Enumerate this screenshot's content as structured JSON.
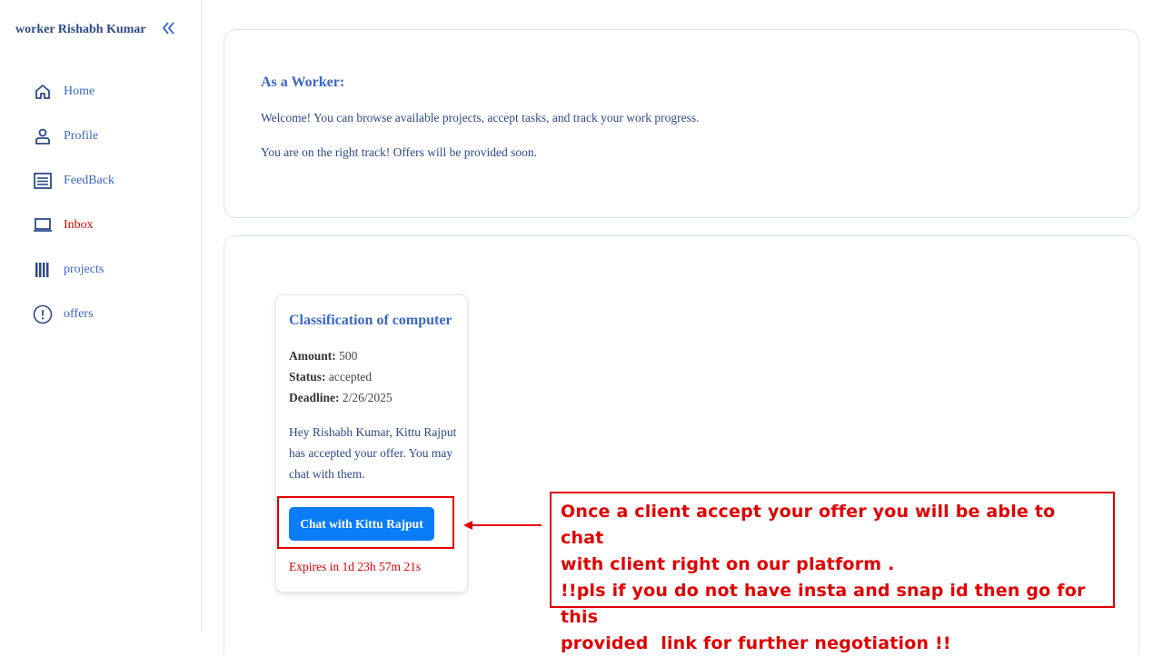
{
  "sidebar": {
    "brand": "worker Rishabh Kumar",
    "collapse_icon": "double-chevron-left-icon",
    "items": [
      {
        "label": "Home",
        "icon": "home-icon"
      },
      {
        "label": "Profile",
        "icon": "user-icon"
      },
      {
        "label": "FeedBack",
        "icon": "list-icon"
      },
      {
        "label": "Inbox",
        "icon": "inbox-icon",
        "active": true
      },
      {
        "label": "projects",
        "icon": "barcode-icon"
      },
      {
        "label": "offers",
        "icon": "alert-circle-icon"
      }
    ]
  },
  "welcome": {
    "title": "As a Worker:",
    "line1": "Welcome! You can browse available projects, accept tasks, and track your work progress.",
    "line2": "You are on the right track! Offers will be provided soon."
  },
  "offer": {
    "title": "Classification of computer",
    "amount_label": "Amount:",
    "amount": "500",
    "status_label": "Status:",
    "status": "accepted",
    "deadline_label": "Deadline:",
    "deadline": "2/26/2025",
    "message": "Hey Rishabh Kumar, Kittu Rajput has accepted your offer. You may chat with them.",
    "chat_button": "Chat with Kittu Rajput",
    "expires": "Expires in 1d 23h 57m 21s"
  },
  "annotation": {
    "line1": "Once a client accept your offer you will be able to chat",
    "line2": "with client right on our platform .",
    "line3": "!!pls if you do not have insta and snap id then go for this",
    "line4": "provided  link for further negotiation !!"
  },
  "colors": {
    "accent": "#3a66c8",
    "active": "#e00000",
    "button": "#0a7cf6"
  }
}
